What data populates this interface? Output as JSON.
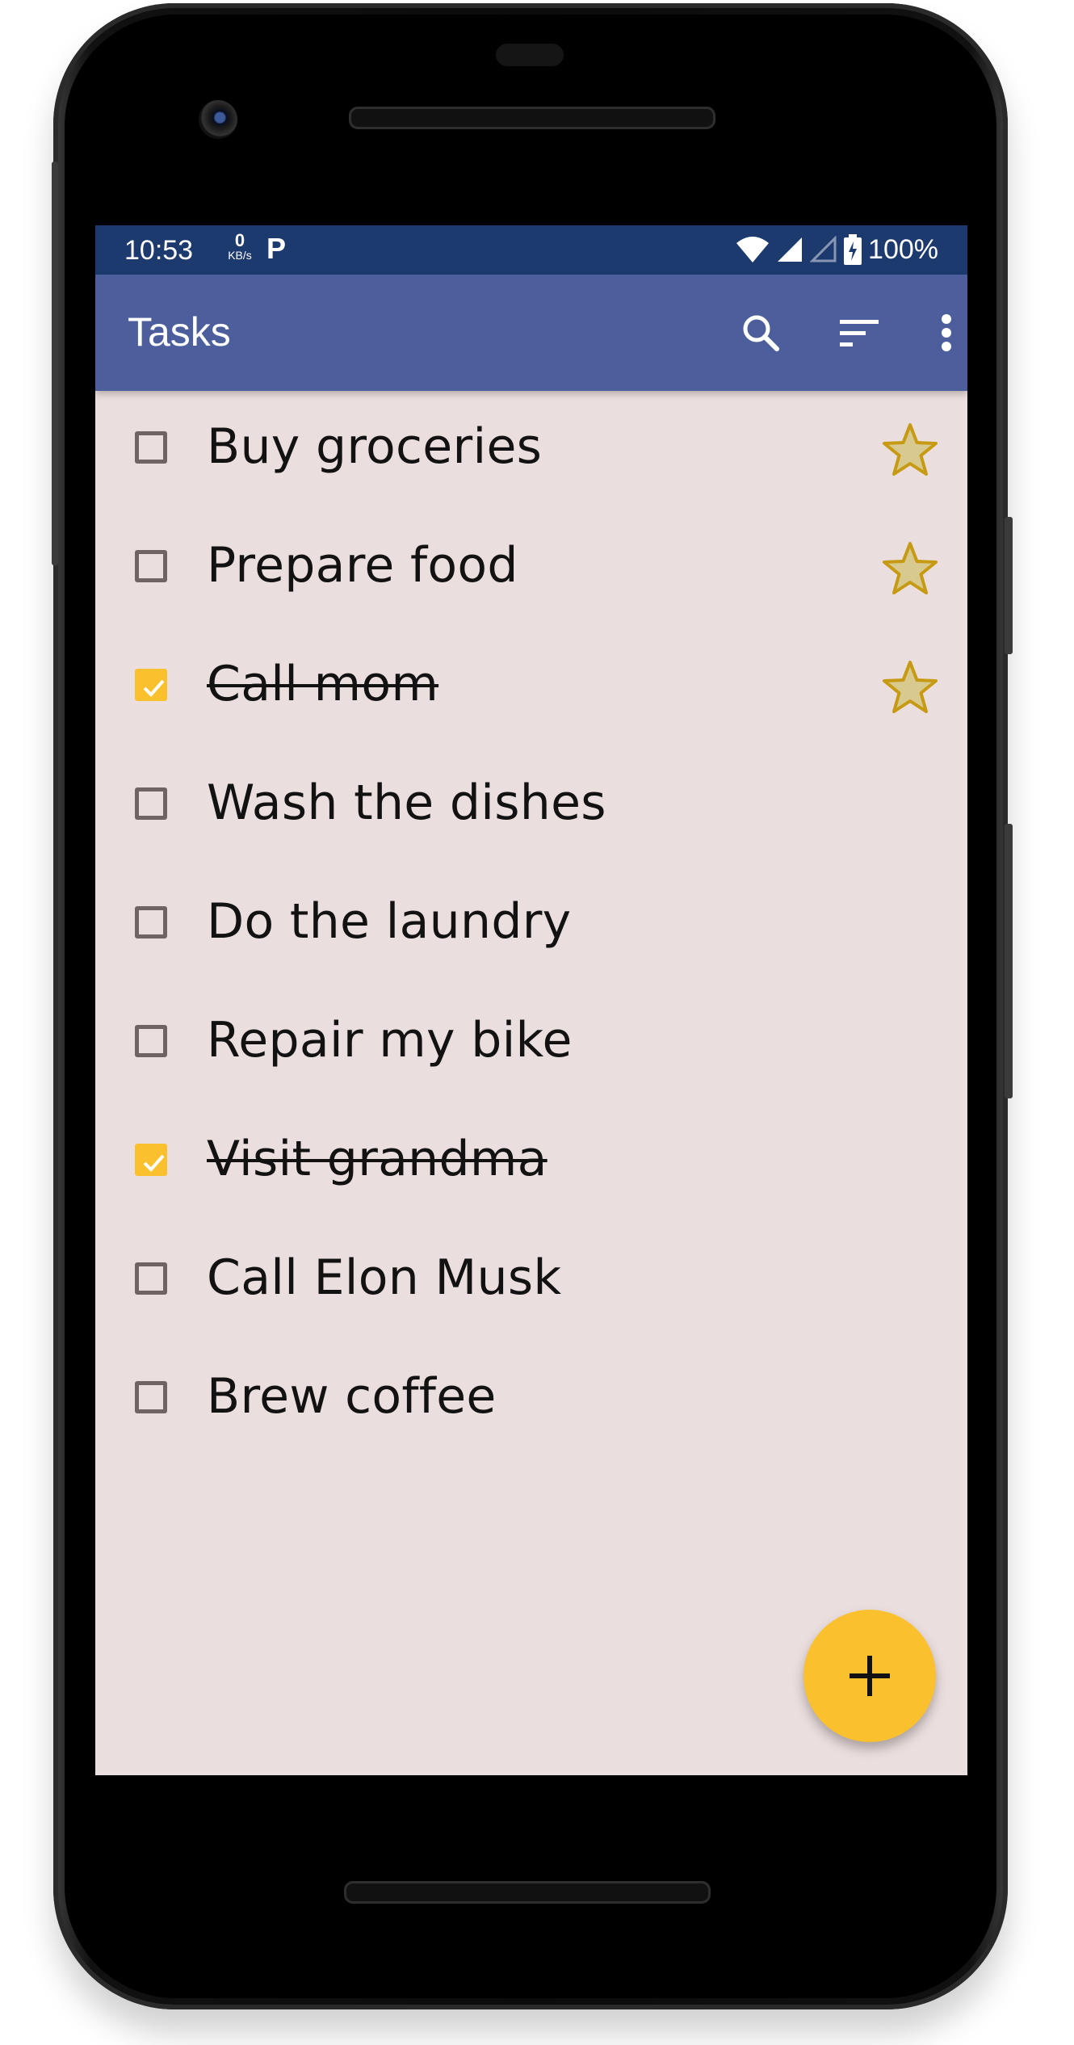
{
  "status_bar": {
    "time": "10:53",
    "net_speed_value": "0",
    "net_speed_unit": "KB/s",
    "notification_letter": "P",
    "battery": "100%"
  },
  "app_bar": {
    "title": "Tasks",
    "icons": [
      "search-icon",
      "sort-icon",
      "more-vert-icon"
    ]
  },
  "tasks": [
    {
      "label": "Buy groceries",
      "checked": false,
      "starred": true
    },
    {
      "label": "Prepare food",
      "checked": false,
      "starred": true
    },
    {
      "label": "Call mom",
      "checked": true,
      "starred": true
    },
    {
      "label": "Wash the dishes",
      "checked": false,
      "starred": false
    },
    {
      "label": "Do the laundry",
      "checked": false,
      "starred": false
    },
    {
      "label": "Repair my bike",
      "checked": false,
      "starred": false
    },
    {
      "label": "Visit grandma",
      "checked": true,
      "starred": false
    },
    {
      "label": "Call Elon Musk",
      "checked": false,
      "starred": false
    },
    {
      "label": "Brew coffee",
      "checked": false,
      "starred": false
    }
  ],
  "fab": {
    "icon": "add-icon"
  },
  "colors": {
    "status_bar": "#1c3a6e",
    "app_bar": "#4c5f9c",
    "background": "#ebdede",
    "accent": "#fbc02d",
    "star_fill": "#d8c98e",
    "star_stroke": "#c79a14"
  }
}
